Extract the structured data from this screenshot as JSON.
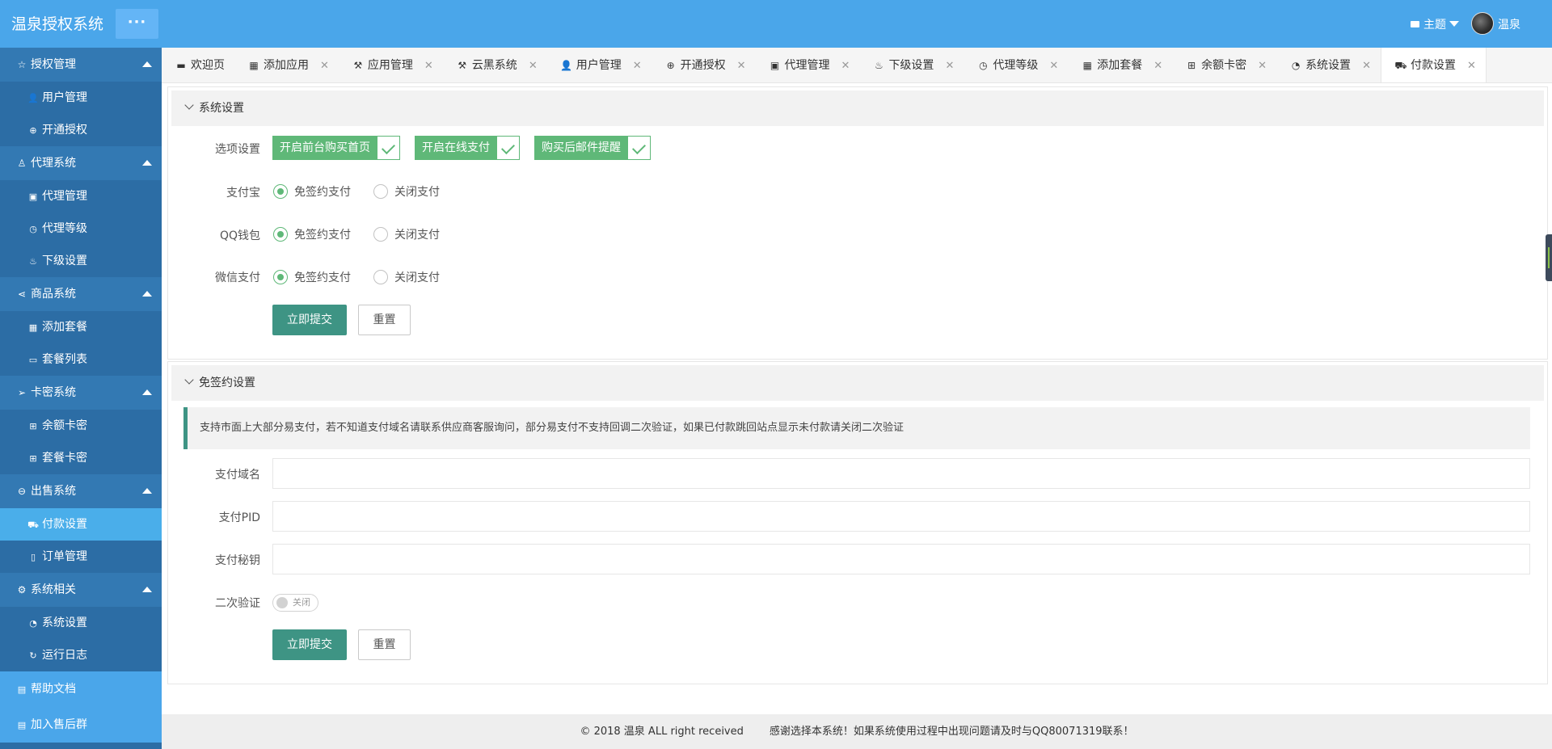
{
  "header": {
    "logo": "温泉授权系统",
    "menu_toggle": "···",
    "theme_label": "主题",
    "username": "温泉"
  },
  "sidebar": {
    "groups": [
      {
        "label": "授权管理",
        "icon": "star-icon",
        "items": [
          {
            "label": "用户管理",
            "icon": "user-icon"
          },
          {
            "label": "开通授权",
            "icon": "plus-circle-icon"
          }
        ]
      },
      {
        "label": "代理系统",
        "icon": "users-icon",
        "items": [
          {
            "label": "代理管理",
            "icon": "picture-icon"
          },
          {
            "label": "代理等级",
            "icon": "clock-icon"
          },
          {
            "label": "下级设置",
            "icon": "fire-icon"
          }
        ]
      },
      {
        "label": "商品系统",
        "icon": "share-icon",
        "items": [
          {
            "label": "添加套餐",
            "icon": "grid-icon"
          },
          {
            "label": "套餐列表",
            "icon": "window-icon"
          }
        ]
      },
      {
        "label": "卡密系统",
        "icon": "send-icon",
        "items": [
          {
            "label": "余额卡密",
            "icon": "apps-icon"
          },
          {
            "label": "套餐卡密",
            "icon": "apps-icon"
          }
        ]
      },
      {
        "label": "出售系统",
        "icon": "yen-circle-icon",
        "items": [
          {
            "label": "付款设置",
            "icon": "cart-icon",
            "active": true
          },
          {
            "label": "订单管理",
            "icon": "file-icon"
          }
        ]
      },
      {
        "label": "系统相关",
        "icon": "gear-icon",
        "items": [
          {
            "label": "系统设置",
            "icon": "dashboard-icon"
          },
          {
            "label": "运行日志",
            "icon": "refresh-icon"
          }
        ]
      }
    ],
    "links": [
      {
        "label": "帮助文档",
        "icon": "doc-icon"
      },
      {
        "label": "加入售后群",
        "icon": "doc-icon"
      }
    ]
  },
  "tabs": [
    {
      "label": "欢迎页",
      "closable": false
    },
    {
      "label": "添加应用",
      "closable": true
    },
    {
      "label": "应用管理",
      "closable": true
    },
    {
      "label": "云黑系统",
      "closable": true
    },
    {
      "label": "用户管理",
      "closable": true
    },
    {
      "label": "开通授权",
      "closable": true
    },
    {
      "label": "代理管理",
      "closable": true
    },
    {
      "label": "下级设置",
      "closable": true
    },
    {
      "label": "代理等级",
      "closable": true
    },
    {
      "label": "添加套餐",
      "closable": true
    },
    {
      "label": "余额卡密",
      "closable": true
    },
    {
      "label": "系统设置",
      "closable": true
    },
    {
      "label": "付款设置",
      "closable": true,
      "active": true
    }
  ],
  "system_settings": {
    "title": "系统设置",
    "options_label": "选项设置",
    "options": [
      "开启前台购买首页",
      "开启在线支付",
      "购买后邮件提醒"
    ],
    "alipay_label": "支付宝",
    "qqwallet_label": "QQ钱包",
    "wechat_label": "微信支付",
    "radio_free": "免签约支付",
    "radio_off": "关闭支付",
    "submit": "立即提交",
    "reset": "重置"
  },
  "free_sign_settings": {
    "title": "免签约设置",
    "notice": "支持市面上大部分易支付，若不知道支付域名请联系供应商客服询问，部分易支付不支持回调二次验证，如果已付款跳回站点显示未付款请关闭二次验证",
    "domain_label": "支付域名",
    "pid_label": "支付PID",
    "secret_label": "支付秘钥",
    "verify_label": "二次验证",
    "verify_state": "关闭",
    "submit": "立即提交",
    "reset": "重置"
  },
  "footer": {
    "copyright": "© 2018 温泉 ALL right received",
    "message": "感谢选择本系统！如果系统使用过程中出现问题请及时与QQ80071319联系！"
  },
  "colors": {
    "header": "#4aa6ea",
    "sidebar": "#2c6da5",
    "sidebar_group": "#3379b3",
    "sidebar_active": "#4aaeea",
    "green": "#5fb878",
    "teal": "#3e9484"
  }
}
